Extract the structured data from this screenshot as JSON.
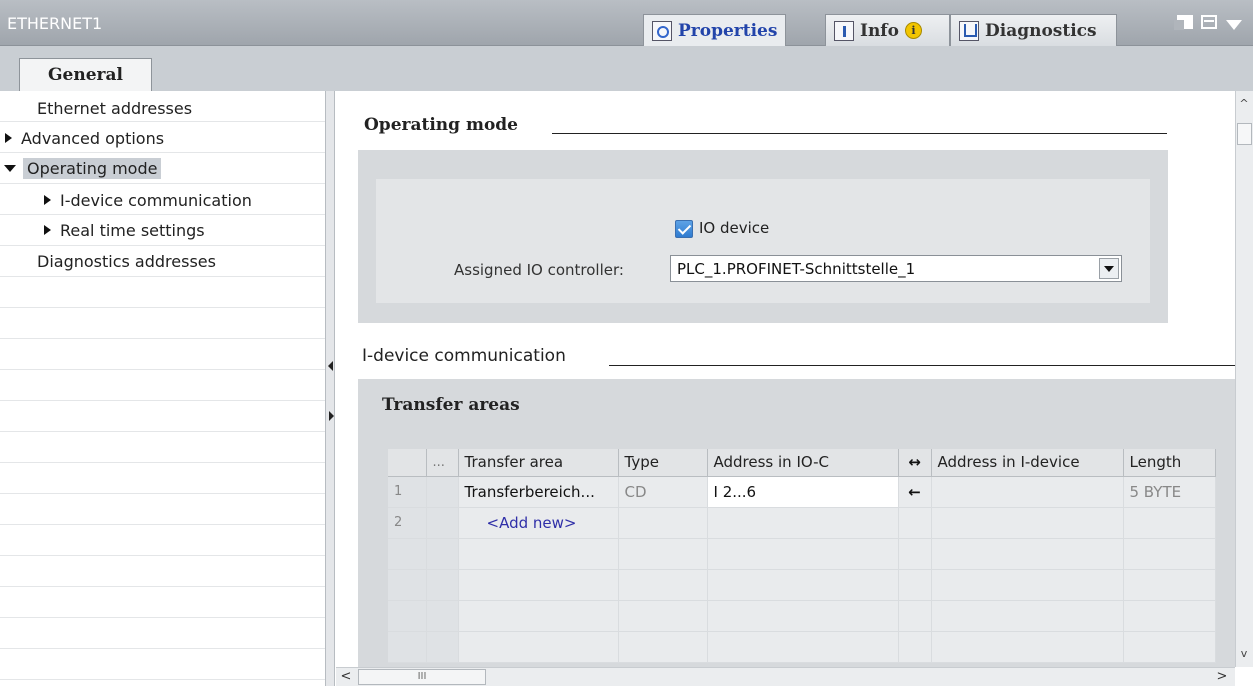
{
  "window": {
    "title": "ETHERNET1"
  },
  "inspector_tabs": [
    {
      "label": "Properties",
      "icon": "properties-icon"
    },
    {
      "label": "Info",
      "icon": "info-icon",
      "badge": "i"
    },
    {
      "label": "Diagnostics",
      "icon": "diagnostics-icon"
    }
  ],
  "tabs": {
    "general": "General"
  },
  "nav": {
    "items": [
      {
        "label": "Ethernet addresses"
      },
      {
        "label": "Advanced options"
      },
      {
        "label": "Operating mode"
      },
      {
        "label": "I-device communication"
      },
      {
        "label": "Real time settings"
      },
      {
        "label": "Diagnostics addresses"
      }
    ]
  },
  "operating_mode": {
    "title": "Operating mode",
    "io_device_label": "IO device",
    "io_device_checked": true,
    "assigned_controller_label": "Assigned IO controller:",
    "assigned_controller_value": "PLC_1.PROFINET-Schnittstelle_1"
  },
  "idevice": {
    "title": "I-device communication",
    "transfer_areas_title": "Transfer areas",
    "columns": [
      "...",
      "Transfer area",
      "Type",
      "Address in IO-C",
      "↔",
      "Address in I-device",
      "Length"
    ],
    "rows": [
      {
        "num": "1",
        "name": "Transferbereich...",
        "type": "CD",
        "address_ioc": "I 2...6",
        "direction": "←",
        "address_idevice": "",
        "length": "5 BYTE"
      },
      {
        "num": "2",
        "name": "<Add new>",
        "type": "",
        "address_ioc": "",
        "direction": "",
        "address_idevice": "",
        "length": ""
      }
    ]
  },
  "colors": {
    "accent": "#2244aa",
    "titlebar": "#a9aeb4",
    "panel": "#d6d9dc",
    "selection": "#c9ced4",
    "checkbox": "#3a86d8"
  }
}
